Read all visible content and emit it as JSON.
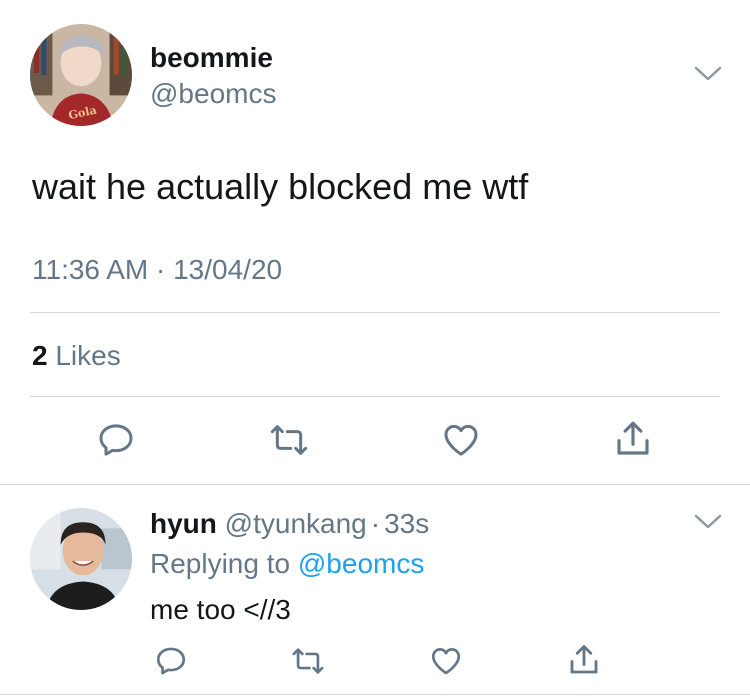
{
  "main_tweet": {
    "display_name": "beommie",
    "handle": "@beomcs",
    "text": "wait he actually blocked me wtf",
    "timestamp": "11:36 AM · 13/04/20",
    "likes_count": "2",
    "likes_label": "Likes",
    "avatar_icon": "profile-photo",
    "avatar_shirt_text": "Gola"
  },
  "reply_tweet": {
    "display_name": "hyun",
    "handle": "@tyunkang",
    "separator": "·",
    "time": "33s",
    "replying_prefix": "Replying to ",
    "replying_to": "@beomcs",
    "text": "me too <//3",
    "avatar_icon": "profile-photo"
  },
  "actions": [
    "reply-icon",
    "retweet-icon",
    "like-icon",
    "share-icon"
  ],
  "colors": {
    "text": "#14171a",
    "secondary": "#657786",
    "link": "#1da1f2",
    "divider": "#ccd6dd"
  }
}
